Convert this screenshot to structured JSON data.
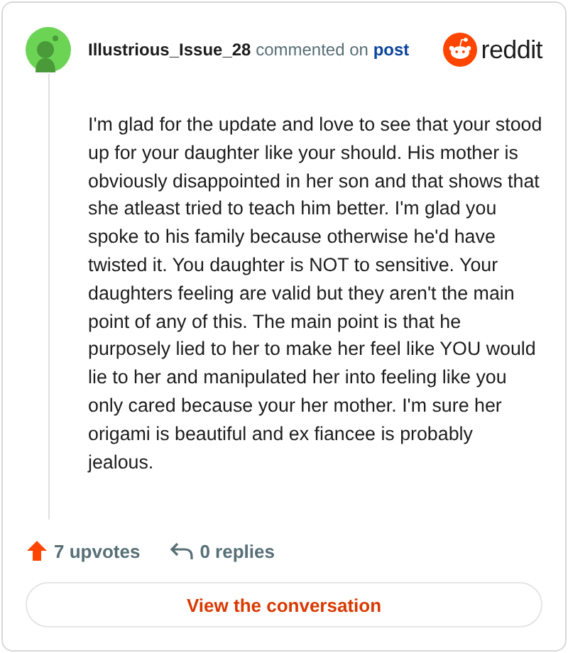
{
  "comment": {
    "author": "Illustrious_Issue_28",
    "action": "commented on",
    "target": "post",
    "brand": "reddit",
    "body": "I'm glad for the update and love to see that your stood up for your daughter like your should. His mother is obviously disappointed in her son and that shows that she atleast tried to teach him better. I'm glad you spoke to his family because otherwise he'd have twisted it. You daughter is NOT to sensitive. Your daughters feeling are valid but they aren't the main point of any of this. The main point is that he purposely lied to her to make her feel like YOU would lie to her and manipulated her into feeling like you only cared because your her mother. I'm sure her origami is beautiful and ex fiancee is probably jealous.",
    "upvotes": "7 upvotes",
    "replies": "0 replies"
  },
  "button": "View the conversation"
}
